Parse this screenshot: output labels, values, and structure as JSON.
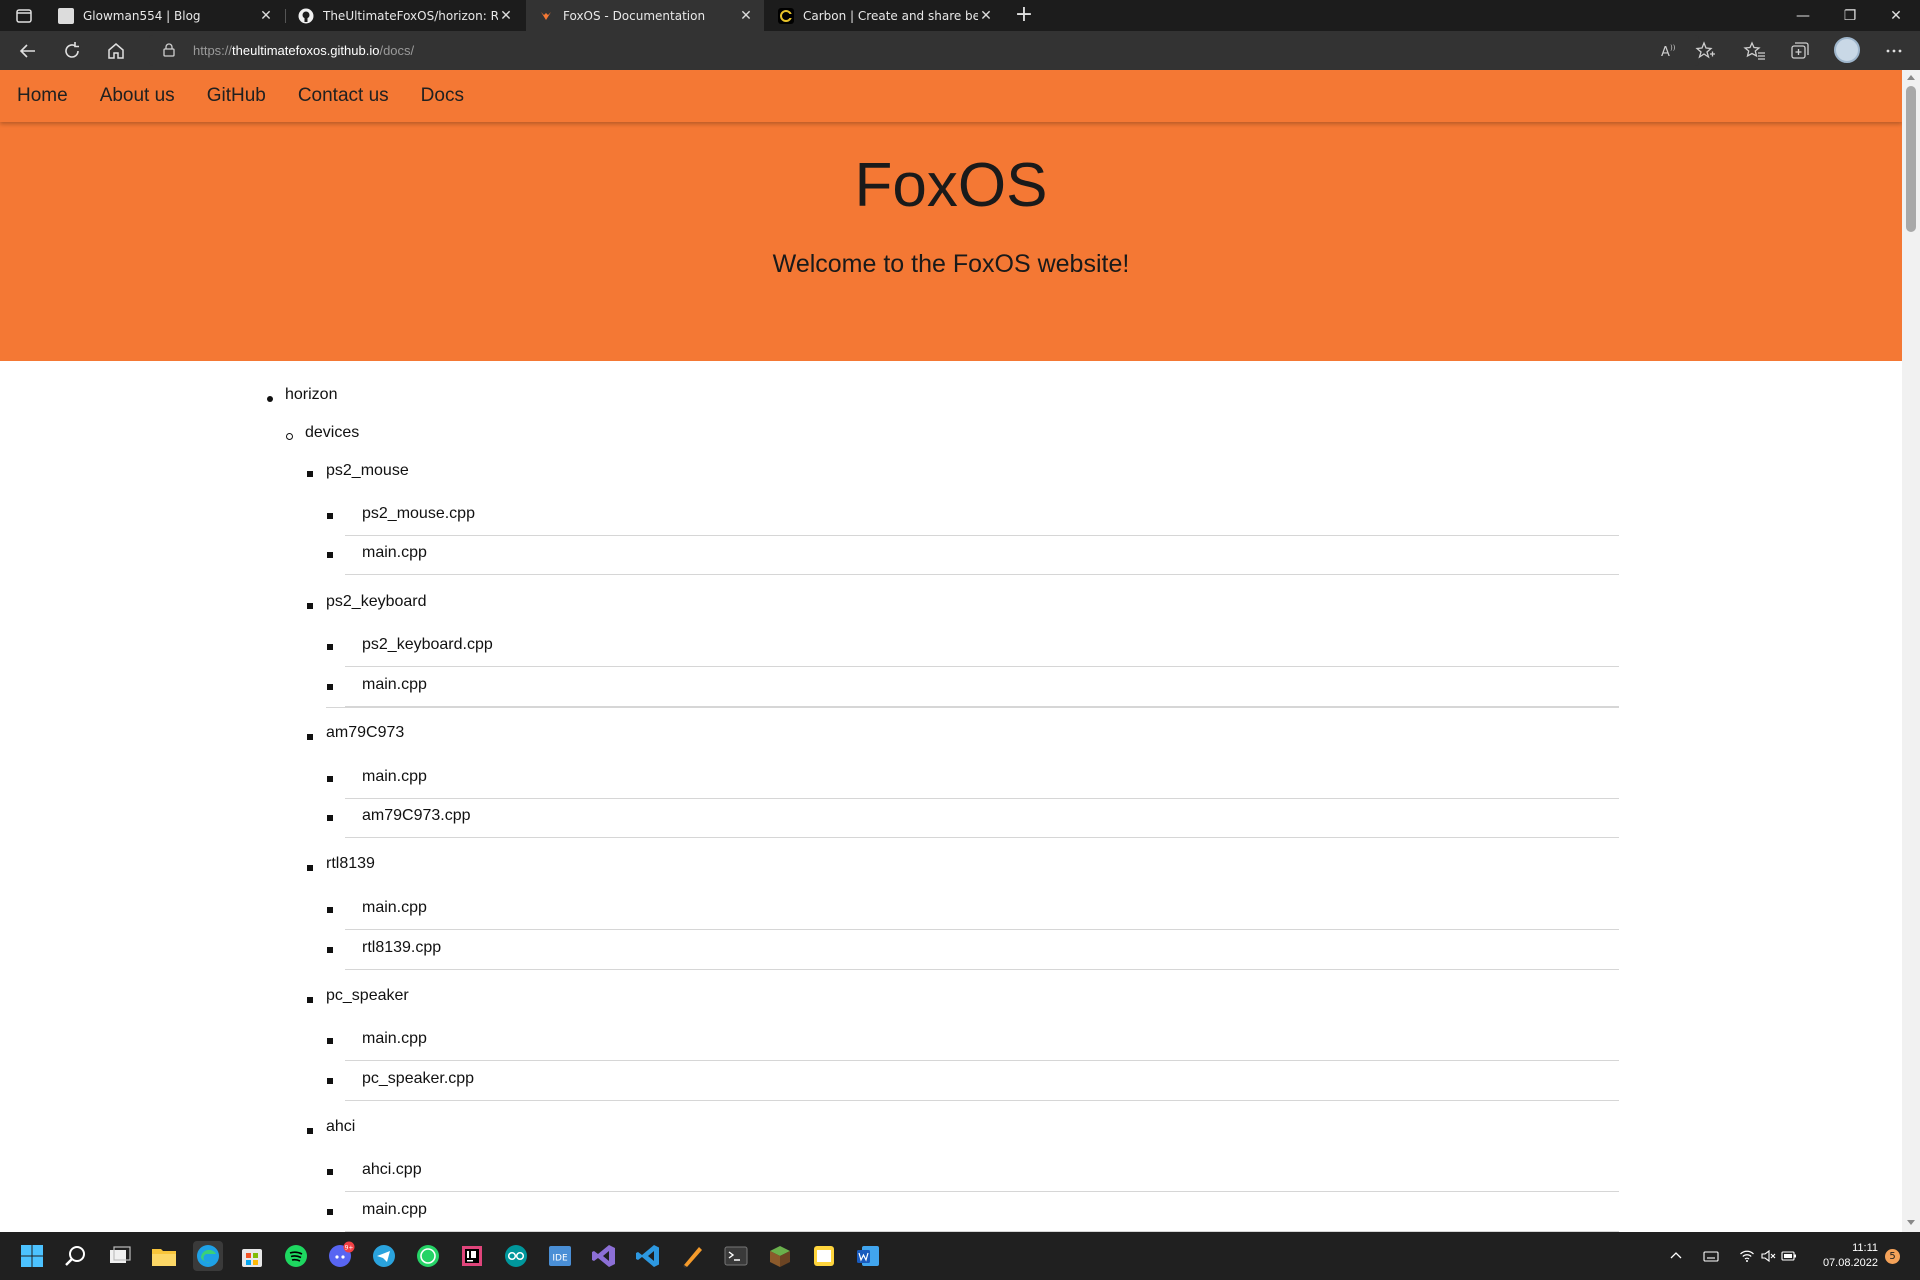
{
  "browser": {
    "tabs": [
      {
        "title": "Glowman554 | Blog",
        "active": false,
        "favicon": "blog-favicon"
      },
      {
        "title": "TheUltimateFoxOS/horizon: Rew",
        "active": false,
        "favicon": "github-icon"
      },
      {
        "title": "FoxOS - Documentation",
        "active": true,
        "favicon": "foxos-favicon"
      },
      {
        "title": "Carbon | Create and share beaut",
        "active": false,
        "favicon": "carbon-favicon"
      }
    ],
    "url_scheme": "https://",
    "url_host": "theultimatefoxos.github.io",
    "url_path": "/docs/"
  },
  "site": {
    "nav": [
      "Home",
      "About us",
      "GitHub",
      "Contact us",
      "Docs"
    ],
    "title": "FoxOS",
    "subtitle": "Welcome to the FoxOS website!",
    "accent_color": "#f47834"
  },
  "tree": {
    "root": "horizon",
    "folder": "devices",
    "groups": [
      {
        "name": "ps2_mouse",
        "files": [
          "ps2_mouse.cpp",
          "main.cpp"
        ]
      },
      {
        "name": "ps2_keyboard",
        "files": [
          "ps2_keyboard.cpp",
          "main.cpp"
        ]
      },
      {
        "name": "am79C973",
        "files": [
          "main.cpp",
          "am79C973.cpp"
        ]
      },
      {
        "name": "rtl8139",
        "files": [
          "main.cpp",
          "rtl8139.cpp"
        ]
      },
      {
        "name": "pc_speaker",
        "files": [
          "main.cpp",
          "pc_speaker.cpp"
        ]
      },
      {
        "name": "ahci",
        "files": [
          "ahci.cpp",
          "main.cpp"
        ]
      }
    ]
  },
  "taskbar": {
    "time": "11:11",
    "date": "07.08.2022",
    "notification_count": "5",
    "discord_badge": "9+",
    "ide_label": "IDE"
  }
}
